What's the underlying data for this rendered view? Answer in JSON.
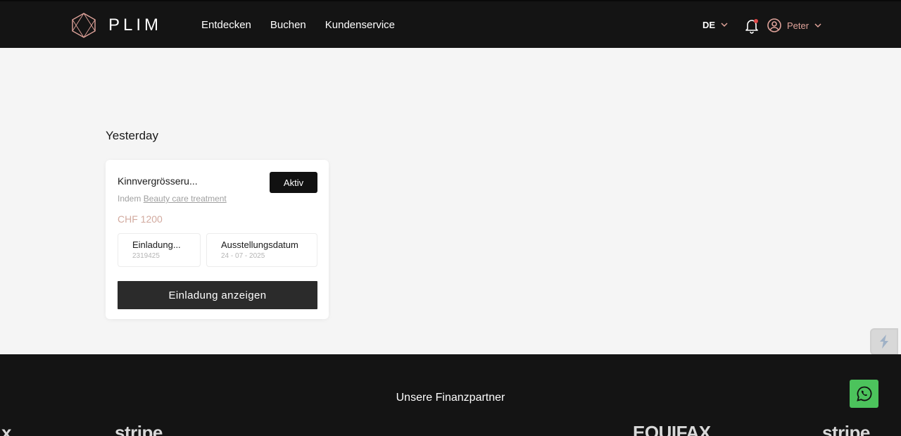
{
  "header": {
    "brand": "PLIM",
    "nav": [
      "Entdecken",
      "Buchen",
      "Kundenservice"
    ],
    "language": "DE",
    "user_name": "Peter",
    "accent_color": "#e0a39a"
  },
  "main": {
    "section_title": "Yesterday",
    "card": {
      "title": "Kinnvergrösseru...",
      "status_badge": "Aktiv",
      "sub_prefix": "Indem",
      "sub_link": "Beauty care treatment",
      "price": "CHF 1200",
      "info": [
        {
          "label": "Einladung...",
          "value": "2319425"
        },
        {
          "label": "Ausstellungsdatum",
          "value": "24 - 07 - 2025"
        }
      ],
      "action_label": "Einladung anzeigen"
    }
  },
  "footer": {
    "title": "Unsere Finanzpartner",
    "partners": [
      "x",
      "stripe",
      "",
      "",
      "EQUIFAX",
      "stripe"
    ]
  },
  "icons": [
    "logo-diamond-icon",
    "chevron-down-icon",
    "bell-icon",
    "user-circle-icon",
    "widget-icon",
    "whatsapp-icon"
  ]
}
